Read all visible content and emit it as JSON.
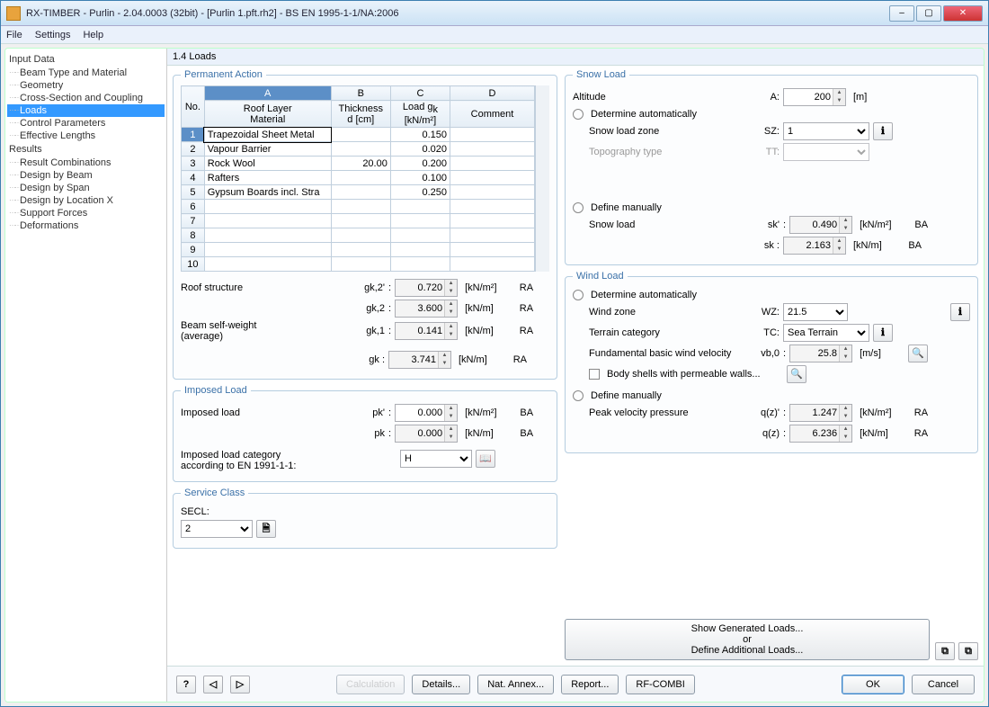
{
  "title": "RX-TIMBER - Purlin - 2.04.0003 (32bit) - [Purlin 1.pft.rh2] - BS EN 1995-1-1/NA:2006",
  "menu": {
    "file": "File",
    "settings": "Settings",
    "help": "Help"
  },
  "tree": {
    "input_hdr": "Input Data",
    "items_input": [
      "Beam Type and Material",
      "Geometry",
      "Cross-Section and Coupling",
      "Loads",
      "Control Parameters",
      "Effective Lengths"
    ],
    "results_hdr": "Results",
    "items_results": [
      "Result Combinations",
      "Design by Beam",
      "Design by Span",
      "Design by Location X",
      "Support Forces",
      "Deformations"
    ]
  },
  "heading": "1.4 Loads",
  "perm": {
    "legend": "Permanent Action",
    "cols": {
      "no": "No.",
      "a_top": "A",
      "a": "Roof Layer\nMaterial",
      "b_top": "B",
      "b": "Thickness\nd [cm]",
      "c_top": "C",
      "c": "Load g k\n[kN/m²]",
      "d_top": "D",
      "d": "Comment"
    },
    "rows": [
      {
        "n": "1",
        "mat": "Trapezoidal Sheet Metal",
        "t": "",
        "g": "0.150",
        "c": ""
      },
      {
        "n": "2",
        "mat": "Vapour Barrier",
        "t": "",
        "g": "0.020",
        "c": ""
      },
      {
        "n": "3",
        "mat": "Rock Wool",
        "t": "20.00",
        "g": "0.200",
        "c": ""
      },
      {
        "n": "4",
        "mat": "Rafters",
        "t": "",
        "g": "0.100",
        "c": ""
      },
      {
        "n": "5",
        "mat": "Gypsum Boards incl. Stra",
        "t": "",
        "g": "0.250",
        "c": ""
      },
      {
        "n": "6"
      },
      {
        "n": "7"
      },
      {
        "n": "8"
      },
      {
        "n": "9"
      },
      {
        "n": "10"
      }
    ],
    "roof_structure": "Roof structure",
    "beam_self": "Beam self-weight\n(average)",
    "gk2p": {
      "sym": "gk,2'",
      "v": "0.720",
      "u": "[kN/m²]",
      "f": "RA"
    },
    "gk2": {
      "sym": "gk,2",
      "v": "3.600",
      "u": "[kN/m]",
      "f": "RA"
    },
    "gk1": {
      "sym": "gk,1",
      "v": "0.141",
      "u": "[kN/m]",
      "f": "RA"
    },
    "gk": {
      "sym": "gk :",
      "v": "3.741",
      "u": "[kN/m]",
      "f": "RA"
    }
  },
  "imposed": {
    "legend": "Imposed Load",
    "lbl": "Imposed load",
    "pkp": {
      "sym": "pk'",
      "v": "0.000",
      "u": "[kN/m²]",
      "f": "BA"
    },
    "pk": {
      "sym": "pk",
      "v": "0.000",
      "u": "[kN/m]",
      "f": "BA"
    },
    "cat_lbl": "Imposed load category\naccording to EN 1991-1-1:",
    "cat": "H"
  },
  "service": {
    "legend": "Service Class",
    "lbl": "SECL:",
    "v": "2"
  },
  "snow": {
    "legend": "Snow Load",
    "altitude": "Altitude",
    "alt_sym": "A:",
    "alt_v": "200",
    "alt_u": "[m]",
    "auto": "Determine automatically",
    "zone": "Snow load zone",
    "zone_sym": "SZ:",
    "zone_v": "1",
    "topo": "Topography type",
    "topo_sym": "TT:",
    "manual": "Define manually",
    "snow_load": "Snow load",
    "skp": {
      "sym": "sk'",
      "v": "0.490",
      "u": "[kN/m²]",
      "f": "BA"
    },
    "sk": {
      "sym": "sk :",
      "v": "2.163",
      "u": "[kN/m]",
      "f": "BA"
    }
  },
  "wind": {
    "legend": "Wind Load",
    "auto": "Determine automatically",
    "wz": "Wind zone",
    "wz_sym": "WZ:",
    "wz_v": "21.5",
    "tc": "Terrain category",
    "tc_sym": "TC:",
    "tc_v": "Sea Terrain",
    "vb": "Fundamental basic wind velocity",
    "vb_sym": "vb,0",
    "vb_v": "25.8",
    "vb_u": "[m/s]",
    "body": "Body shells with permeable walls...",
    "manual": "Define manually",
    "peak": "Peak velocity pressure",
    "qzp": {
      "sym": "q(z)'",
      "v": "1.247",
      "u": "[kN/m²]",
      "f": "RA"
    },
    "qz": {
      "sym": "q(z)",
      "v": "6.236",
      "u": "[kN/m]",
      "f": "RA"
    }
  },
  "gen": {
    "show": "Show Generated Loads...",
    "or": "or",
    "def": "Define Additional Loads..."
  },
  "footer": {
    "calc": "Calculation",
    "details": "Details...",
    "nat": "Nat. Annex...",
    "report": "Report...",
    "combi": "RF-COMBI",
    "ok": "OK",
    "cancel": "Cancel"
  }
}
